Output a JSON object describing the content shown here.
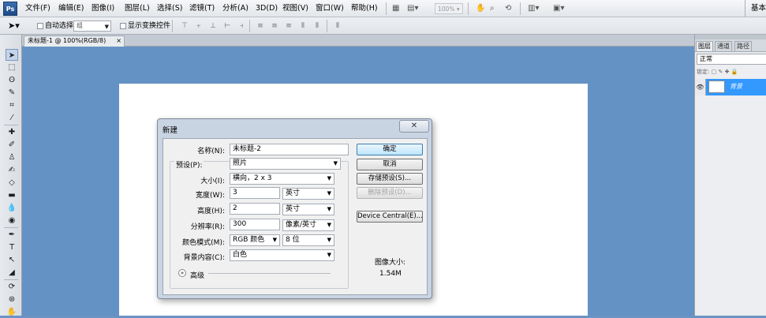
{
  "app": {
    "logo": "Ps",
    "workspace_label": "基本"
  },
  "menu": [
    "文件(F)",
    "编辑(E)",
    "图像(I)",
    "图层(L)",
    "选择(S)",
    "滤镜(T)",
    "分析(A)",
    "3D(D)",
    "视图(V)",
    "窗口(W)",
    "帮助(H)"
  ],
  "menubar": {
    "zoom": "100%"
  },
  "options": {
    "auto_select_label": "自动选择:",
    "auto_select_value": "组",
    "show_transform_label": "显示变换控件"
  },
  "document_tab": {
    "title": "未标题-1 @ 100%(RGB/8)",
    "close": "×"
  },
  "layers_panel": {
    "tabs": [
      "图层",
      "通道",
      "路径"
    ],
    "blend_mode": "正常",
    "lock_label": "锁定:",
    "layer_name": "背景"
  },
  "dialog": {
    "title": "新建",
    "close": "✕",
    "name_label": "名称(N):",
    "name_value": "未标题-2",
    "preset_label": "预设(P):",
    "preset_value": "照片",
    "size_label": "大小(I):",
    "size_value": "横向，2 x 3",
    "width_label": "宽度(W):",
    "width_value": "3",
    "width_unit": "英寸",
    "height_label": "高度(H):",
    "height_value": "2",
    "height_unit": "英寸",
    "resolution_label": "分辨率(R):",
    "resolution_value": "300",
    "resolution_unit": "像素/英寸",
    "color_mode_label": "颜色模式(M):",
    "color_mode_value": "RGB 颜色",
    "bit_depth": "8 位",
    "background_label": "背景内容(C):",
    "background_value": "白色",
    "advanced_label": "高级",
    "ok": "确定",
    "cancel": "取消",
    "save_preset": "存储预设(S)...",
    "delete_preset": "删除预设(D)...",
    "device_central": "Device Central(E)...",
    "image_size_label": "图像大小:",
    "image_size_value": "1.54M"
  }
}
